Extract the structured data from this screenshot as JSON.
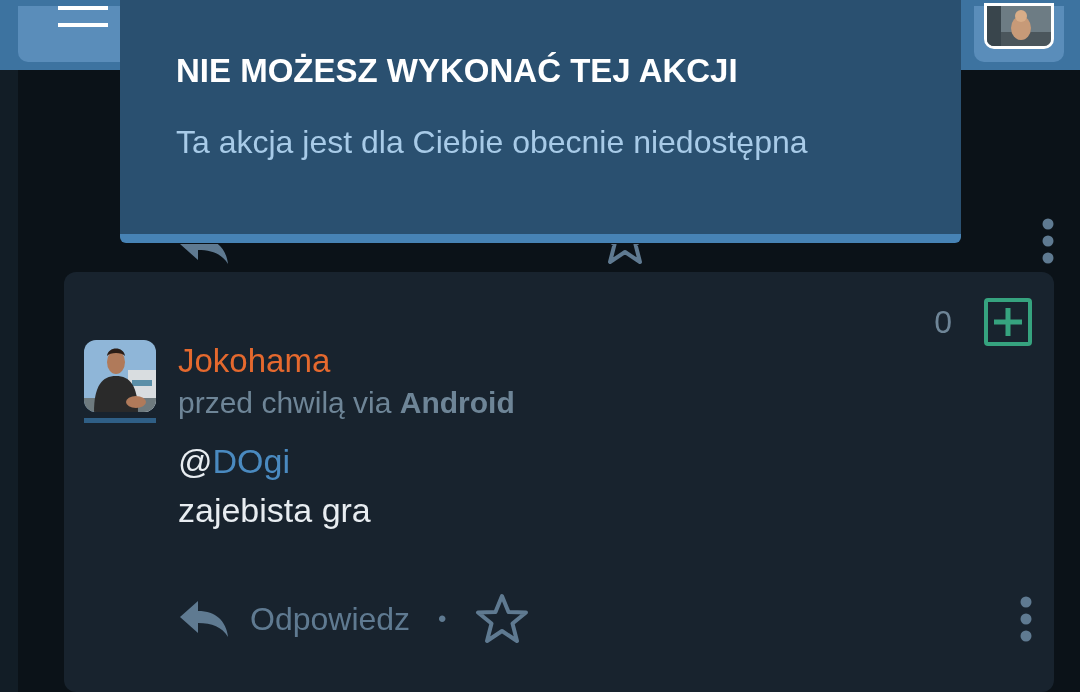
{
  "toast": {
    "title": "NIE MOŻESZ WYKONAĆ TEJ AKCJI",
    "message": "Ta akcja jest dla Ciebie obecnie niedostępna"
  },
  "comment": {
    "votes": "0",
    "author": "Jokohama",
    "time": "przed chwilą via",
    "client": "Android",
    "mention_prefix": "@",
    "mention": "DOgi",
    "text": "zajebista gra",
    "reply": "Odpowiedz",
    "separator": "•"
  }
}
